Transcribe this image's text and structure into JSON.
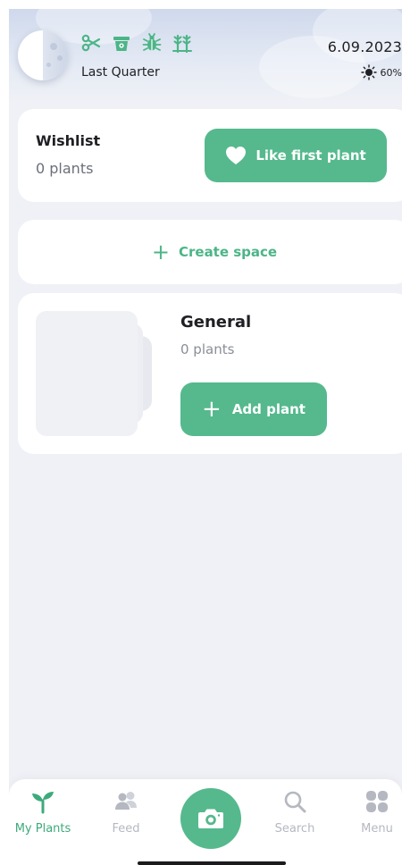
{
  "header": {
    "moon_phase": "Last Quarter",
    "date": "6.09.2023",
    "humidity": "60%",
    "activity_icons": [
      "scissors-icon",
      "pot-icon",
      "bug-icon",
      "seedlings-icon"
    ]
  },
  "wishlist": {
    "title": "Wishlist",
    "count": "0 plants",
    "button_label": "Like first plant"
  },
  "create_space": {
    "label": "Create space"
  },
  "space": {
    "title": "General",
    "count": "0 plants",
    "button_label": "Add plant"
  },
  "nav": {
    "items": [
      {
        "label": "My Plants",
        "icon": "sprout-icon",
        "active": true
      },
      {
        "label": "Feed",
        "icon": "people-icon",
        "active": false
      },
      {
        "label": "",
        "icon": "camera-icon",
        "active": false
      },
      {
        "label": "Search",
        "icon": "search-icon",
        "active": false
      },
      {
        "label": "Menu",
        "icon": "menu-grid-icon",
        "active": false
      }
    ]
  },
  "colors": {
    "accent": "#55b98d",
    "active_nav": "#3eaa7b",
    "inactive_nav": "#b5b8c0",
    "background": "#eff1f6"
  }
}
